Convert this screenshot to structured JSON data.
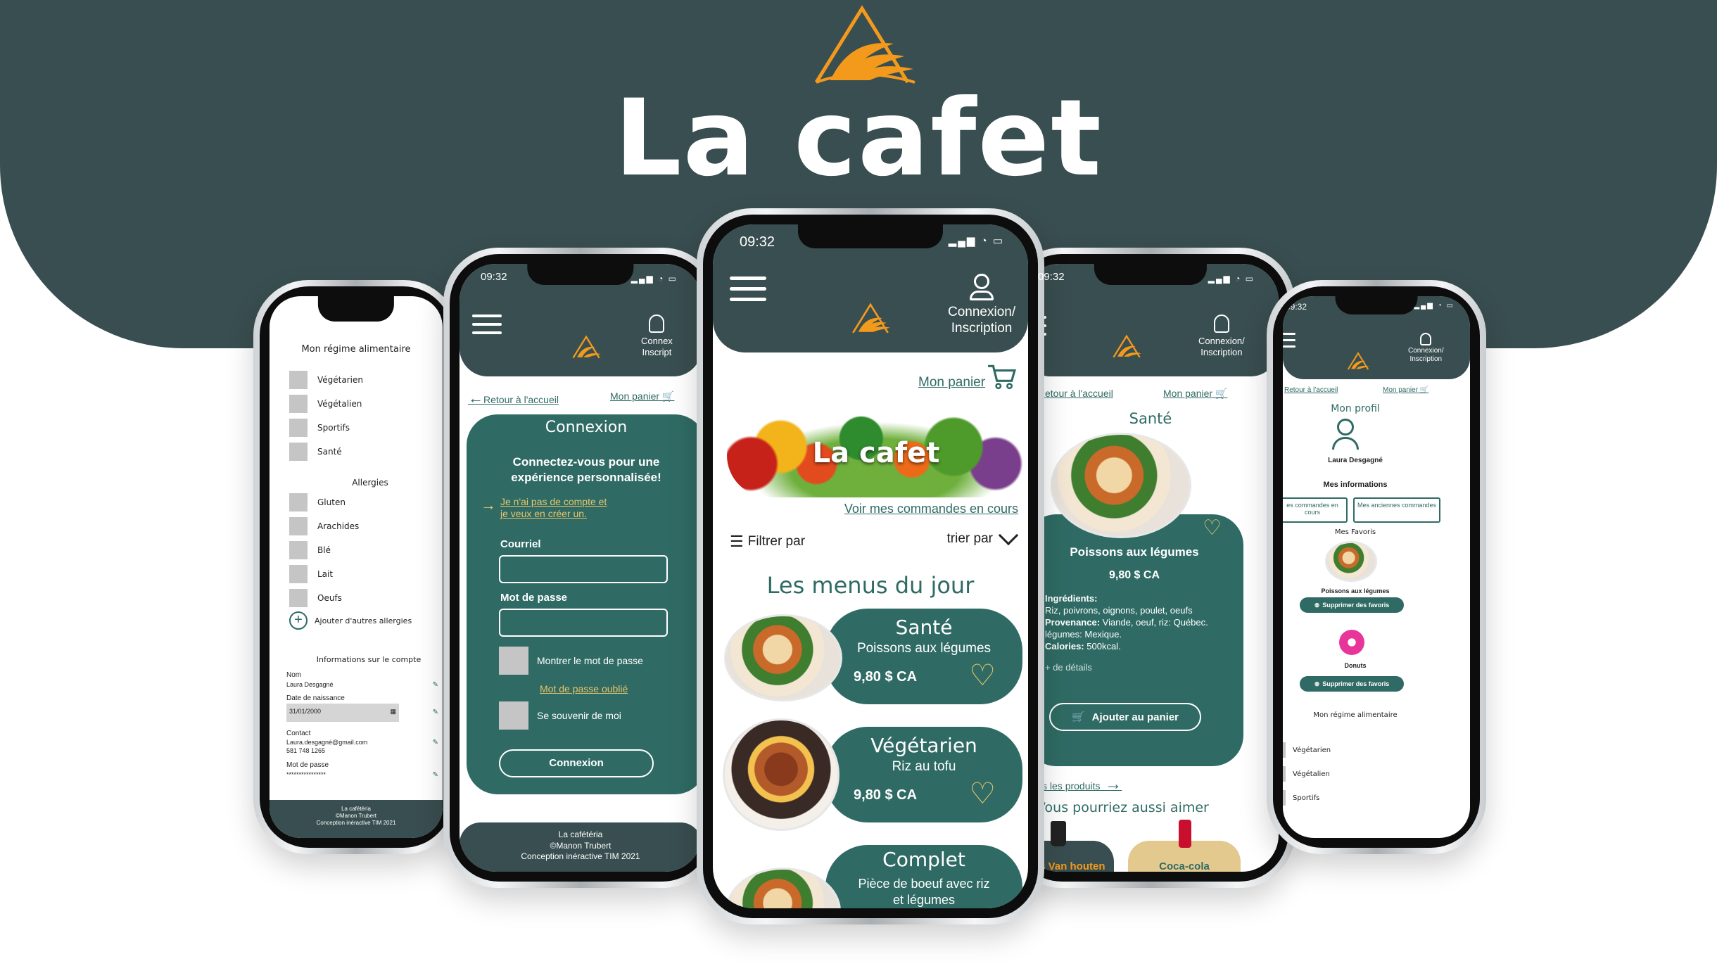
{
  "brand": {
    "title": "La cafet",
    "accent": "#f39a1c",
    "dark": "#394e50",
    "teal": "#2f6b64"
  },
  "status": {
    "time": "09:32"
  },
  "header": {
    "account_line1": "Connexion/",
    "account_line2": "Inscription",
    "account_short1": "Connex",
    "account_short2": "Inscript"
  },
  "nav": {
    "back": "Retour à l'accueil",
    "cart": "Mon panier"
  },
  "home": {
    "hero_text": "La cafet",
    "orders_link": "Voir mes commandes en cours",
    "filter": "Filtrer par",
    "sort": "trier par",
    "section_title": "Les menus du jour",
    "menus": [
      {
        "category": "Santé",
        "dish": "Poissons aux légumes",
        "price": "9,80 $ CA"
      },
      {
        "category": "Végétarien",
        "dish": "Riz au tofu",
        "price": "9,80 $ CA"
      },
      {
        "category": "Complet",
        "dish": "Pièce de boeuf avec riz et légumes",
        "price": ""
      }
    ]
  },
  "login": {
    "title": "Connexion",
    "subtitle": "Connectez-vous pour une expérience personnalisée!",
    "no_account_1": "Je n'ai pas de compte et",
    "no_account_2": "je veux en créer un.",
    "email_label": "Courriel",
    "password_label": "Mot de passe",
    "show_password": "Montrer le mot de passe",
    "forgot": "Mot de passe oublié",
    "remember": "Se souvenir de moi",
    "submit": "Connexion"
  },
  "footer": {
    "line1": "La cafétéria",
    "line2": "©Manon Trubert",
    "line3": "Conception inéractive TIM 2021"
  },
  "diet": {
    "title": "Mon régime alimentaire",
    "options": [
      "Végétarien",
      "Végétalien",
      "Sportifs",
      "Santé"
    ],
    "allergies_title": "Allergies",
    "allergies": [
      "Gluten",
      "Arachides",
      "Blé",
      "Lait",
      "Oeufs"
    ],
    "add_allergies": "Ajouter d'autres allergies",
    "account_title": "Informations sur le compte",
    "name_label": "Nom",
    "name_value": "Laura Desgagné",
    "birth_label": "Date de naissance",
    "birth_value": "31/01/2000",
    "contact_label": "Contact",
    "contact_email": "Laura.desgagné@gmail.com",
    "contact_phone": "581 748 1265",
    "password_label": "Mot de passe",
    "password_value": "****************"
  },
  "product": {
    "category": "Santé",
    "name": "Poissons aux légumes",
    "price": "9,80 $ CA",
    "ingredients_label": "Ingrédients:",
    "ingredients": "Riz, poivrons, oignons, poulet, oeufs",
    "origin_label": "Provenance:",
    "origin": "Viande, oeuf, riz: Québec. légumes: Mexique.",
    "calories_label": "Calories:",
    "calories": "500kcal.",
    "more": "+ de détails",
    "add_to_cart": "Ajouter au panier",
    "all_products": "r tous les produits",
    "suggest_title": "Vous pourriez aussi aimer",
    "suggest_1": "afés Van houten",
    "suggest_2": "Coca-cola"
  },
  "profile": {
    "title": "Mon profil",
    "user": "Laura Desgagné",
    "info_title": "Mes informations",
    "tab_current": "es commandes en cours",
    "tab_old": "Mes anciennes commandes",
    "favorites_title": "Mes Favoris",
    "fav_1": "Poissons aux légumes",
    "fav_2": "Donuts",
    "remove_fav": "Supprimer des favoris",
    "diet_title": "Mon régime alimentaire",
    "diet_1": "Végétarien",
    "diet_2": "Végétalien",
    "diet_3": "Sportifs"
  }
}
